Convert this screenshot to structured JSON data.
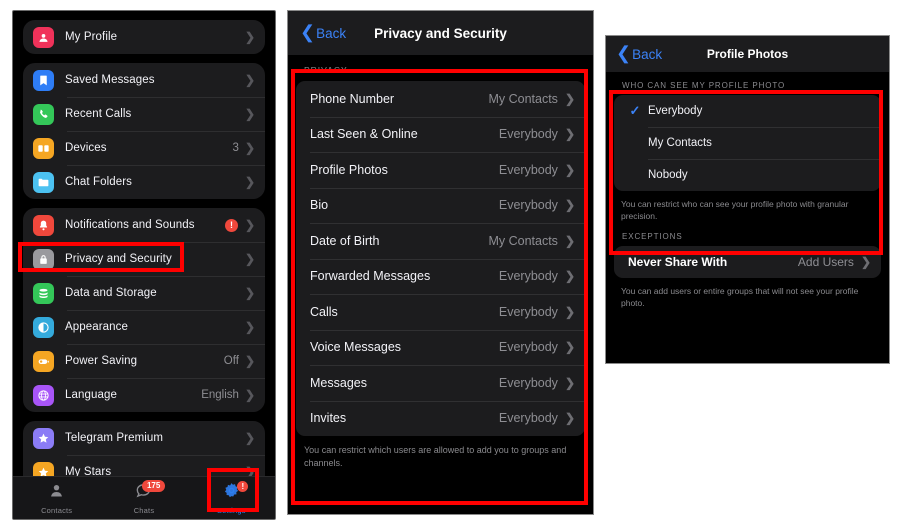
{
  "panel1": {
    "groups": [
      {
        "id": "profile",
        "rows": [
          {
            "label": "My Profile",
            "value": "",
            "icon": "person-circle-icon",
            "color": "#f0325a",
            "badge": ""
          }
        ]
      },
      {
        "id": "chats",
        "rows": [
          {
            "label": "Saved Messages",
            "value": "",
            "icon": "bookmark-icon",
            "color": "#2e7df6",
            "badge": ""
          },
          {
            "label": "Recent Calls",
            "value": "",
            "icon": "phone-icon",
            "color": "#34c759",
            "badge": ""
          },
          {
            "label": "Devices",
            "value": "3",
            "icon": "devices-icon",
            "color": "#f5a623",
            "badge": ""
          },
          {
            "label": "Chat Folders",
            "value": "",
            "icon": "folder-icon",
            "color": "#4cc2f1",
            "badge": ""
          }
        ]
      },
      {
        "id": "settings",
        "rows": [
          {
            "label": "Notifications and Sounds",
            "value": "",
            "icon": "bell-icon",
            "color": "#f0483c",
            "badge": "!"
          },
          {
            "label": "Privacy and Security",
            "value": "",
            "icon": "lock-icon",
            "color": "#9a9a9e",
            "badge": ""
          },
          {
            "label": "Data and Storage",
            "value": "",
            "icon": "database-icon",
            "color": "#34c759",
            "badge": ""
          },
          {
            "label": "Appearance",
            "value": "",
            "icon": "contrast-icon",
            "color": "#34aadc",
            "badge": ""
          },
          {
            "label": "Power Saving",
            "value": "Off",
            "icon": "battery-icon",
            "color": "#f5a623",
            "badge": ""
          },
          {
            "label": "Language",
            "value": "English",
            "icon": "globe-icon",
            "color": "#a855f7",
            "badge": ""
          }
        ]
      },
      {
        "id": "premium",
        "rows": [
          {
            "label": "Telegram Premium",
            "value": "",
            "icon": "star-premium-icon",
            "color": "#8b7cf6",
            "badge": ""
          },
          {
            "label": "My Stars",
            "value": "",
            "icon": "star-icon",
            "color": "#f5a623",
            "badge": ""
          }
        ]
      }
    ],
    "tabbar": [
      {
        "label": "Contacts",
        "icon": "contacts-icon",
        "badge": "",
        "active": false
      },
      {
        "label": "Chats",
        "icon": "chats-icon",
        "badge": "175",
        "active": false
      },
      {
        "label": "Settings",
        "icon": "settings-gear-icon",
        "badge": "!",
        "active": true
      }
    ]
  },
  "panel2": {
    "back_label": "Back",
    "title": "Privacy and Security",
    "section_header": "PRIVACY",
    "rows": [
      {
        "label": "Phone Number",
        "value": "My Contacts"
      },
      {
        "label": "Last Seen & Online",
        "value": "Everybody"
      },
      {
        "label": "Profile Photos",
        "value": "Everybody"
      },
      {
        "label": "Bio",
        "value": "Everybody"
      },
      {
        "label": "Date of Birth",
        "value": "My Contacts"
      },
      {
        "label": "Forwarded Messages",
        "value": "Everybody"
      },
      {
        "label": "Calls",
        "value": "Everybody"
      },
      {
        "label": "Voice Messages",
        "value": "Everybody"
      },
      {
        "label": "Messages",
        "value": "Everybody"
      },
      {
        "label": "Invites",
        "value": "Everybody"
      }
    ],
    "footnote": "You can restrict which users are allowed to add you to groups and channels."
  },
  "panel3": {
    "back_label": "Back",
    "title": "Profile Photos",
    "section_header": "WHO CAN SEE MY PROFILE PHOTO",
    "options": [
      {
        "label": "Everybody",
        "selected": true
      },
      {
        "label": "My Contacts",
        "selected": false
      },
      {
        "label": "Nobody",
        "selected": false
      }
    ],
    "options_footnote": "You can restrict who can see your profile photo with granular precision.",
    "exceptions_header": "EXCEPTIONS",
    "exception_row": {
      "label": "Never Share With",
      "value": "Add Users"
    },
    "exceptions_footnote": "You can add users or entire groups that will not see your profile photo."
  },
  "annotations": {
    "highlight_color": "#ff0000",
    "boxes": [
      {
        "name": "privacy-and-security-item"
      },
      {
        "name": "settings-tab"
      },
      {
        "name": "privacy-list"
      },
      {
        "name": "who-can-see-options"
      }
    ]
  },
  "glyphs": {
    "chevron_right": "›",
    "chevron_left": "‹",
    "check": "✓"
  }
}
